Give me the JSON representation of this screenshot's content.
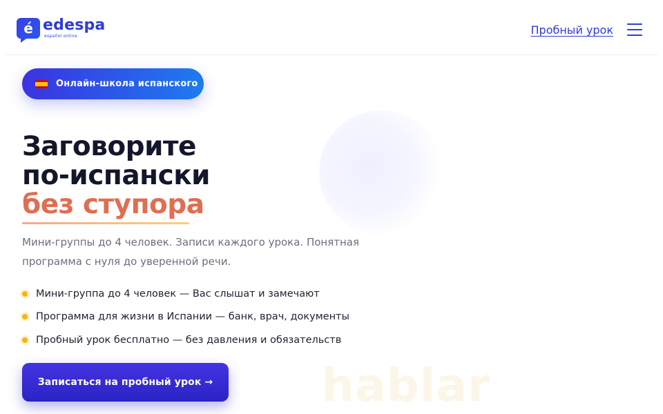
{
  "header": {
    "logo": {
      "mark_letter": "é",
      "name": "edespa",
      "tagline": "español online"
    },
    "trial_link": "Пробный урок",
    "menu_icon": "hamburger-menu-icon"
  },
  "hero": {
    "badge": {
      "flag_icon": "spain-flag-icon",
      "label": "Онлайн-школа испанского"
    },
    "title_line1": "Заговорите",
    "title_line2": "по-испански",
    "title_accent": "без ступора",
    "subtitle": "Мини-группы до 4 человек. Записи каждого урока. Понятная программа с нуля до уверенной речи.",
    "features": [
      "Мини-группа до 4 человек — Вас слышат и замечают",
      "Программа для жизни в Испании — банк, врач, документы",
      "Пробный урок бесплатно — без давления и обязательств"
    ],
    "cta_label": "Записаться на пробный урок →",
    "watermark": "hablar"
  },
  "colors": {
    "brand": "#2f3bd8",
    "accent": "#df6e52",
    "bullet": "#f7b21b",
    "cta": "#3a2ed8"
  }
}
